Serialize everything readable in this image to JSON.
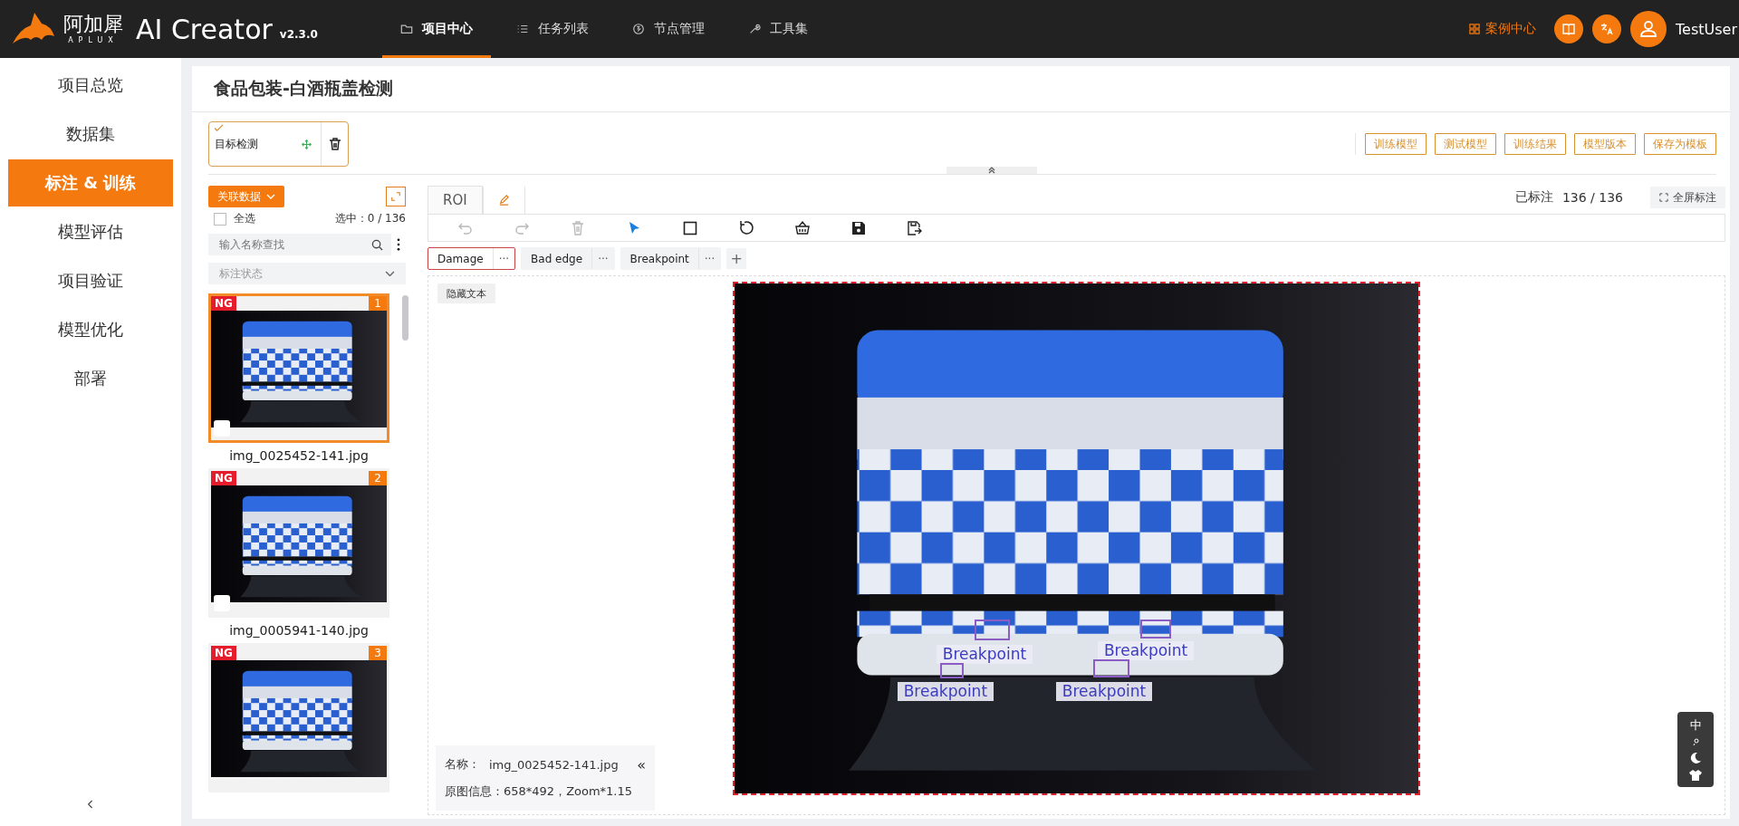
{
  "header": {
    "logo_text": "阿加犀",
    "logo_sub": "APLUX",
    "app_name": "AI Creator",
    "version": "v2.3.0",
    "nav": [
      {
        "label": "项目中心",
        "kind": "folder",
        "selected": true
      },
      {
        "label": "任务列表",
        "kind": "list",
        "selected": false
      },
      {
        "label": "节点管理",
        "kind": "node",
        "selected": false
      },
      {
        "label": "工具集",
        "kind": "wrench",
        "selected": false
      }
    ],
    "case_center": "案例中心",
    "user": "TestUser"
  },
  "sidebar": {
    "items": [
      {
        "label": "项目总览",
        "selected": false
      },
      {
        "label": "数据集",
        "selected": false
      },
      {
        "label": "标注 & 训练",
        "selected": true
      },
      {
        "label": "模型评估",
        "selected": false
      },
      {
        "label": "项目验证",
        "selected": false
      },
      {
        "label": "模型优化",
        "selected": false
      },
      {
        "label": "部署",
        "selected": false
      }
    ]
  },
  "page_title": "食品包装-白酒瓶盖检测",
  "task_card": {
    "label": "目标检测",
    "checked": true
  },
  "actions": [
    "训练模型",
    "测试模型",
    "训练结果",
    "模型版本",
    "保存为模板"
  ],
  "left_panel": {
    "link_button": "关联数据",
    "select_all": {
      "label": "全选",
      "checked": false
    },
    "selection_count": "选中：0 / 136",
    "search": {
      "placeholder": "输入名称查找"
    },
    "status_filter": {
      "placeholder": "标注状态"
    },
    "thumbnails": [
      {
        "badge": "NG",
        "number": "1",
        "name": "img_0025452-141.jpg",
        "selected": true,
        "checked": false
      },
      {
        "badge": "NG",
        "number": "2",
        "name": "img_0005941-140.jpg",
        "selected": false,
        "checked": false
      },
      {
        "badge": "NG",
        "number": "3",
        "selected": false
      }
    ]
  },
  "tabs": [
    {
      "kind": "text",
      "label": "ROI",
      "selected": false
    },
    {
      "kind": "edit",
      "selected": true
    }
  ],
  "annotated": {
    "label": "已标注",
    "count": "136 / 136"
  },
  "fullscreen_button": "全屏标注",
  "tools": [
    {
      "kind": "undo",
      "disabled": true,
      "selected": false
    },
    {
      "kind": "redo",
      "disabled": true,
      "selected": false
    },
    {
      "kind": "delete",
      "disabled": true,
      "selected": false
    },
    {
      "kind": "pointer",
      "disabled": false,
      "selected": true
    },
    {
      "kind": "rectangle",
      "disabled": false,
      "selected": false
    },
    {
      "kind": "rotate",
      "disabled": false,
      "selected": false
    },
    {
      "kind": "basket",
      "disabled": false,
      "selected": false
    },
    {
      "kind": "save",
      "disabled": false,
      "selected": false
    },
    {
      "kind": "export",
      "disabled": false,
      "selected": false
    }
  ],
  "labels": [
    {
      "name": "Damage",
      "more": "···",
      "selected": true
    },
    {
      "name": "Bad edge",
      "more": "···",
      "selected": false
    },
    {
      "name": "Breakpoint",
      "more": "···",
      "selected": false
    }
  ],
  "add_label": "+",
  "hide_text_button": "隐藏文本",
  "annotations": [
    {
      "label": "Breakpoint"
    },
    {
      "label": "Breakpoint"
    },
    {
      "label": "Breakpoint"
    },
    {
      "label": "Breakpoint"
    }
  ],
  "image_info": {
    "name_label": "名称：",
    "name": "img_0025452-141.jpg",
    "collapse": "«",
    "meta": "原图信息：658*492，Zoom*1.15"
  },
  "widget": {
    "lang": "中"
  }
}
